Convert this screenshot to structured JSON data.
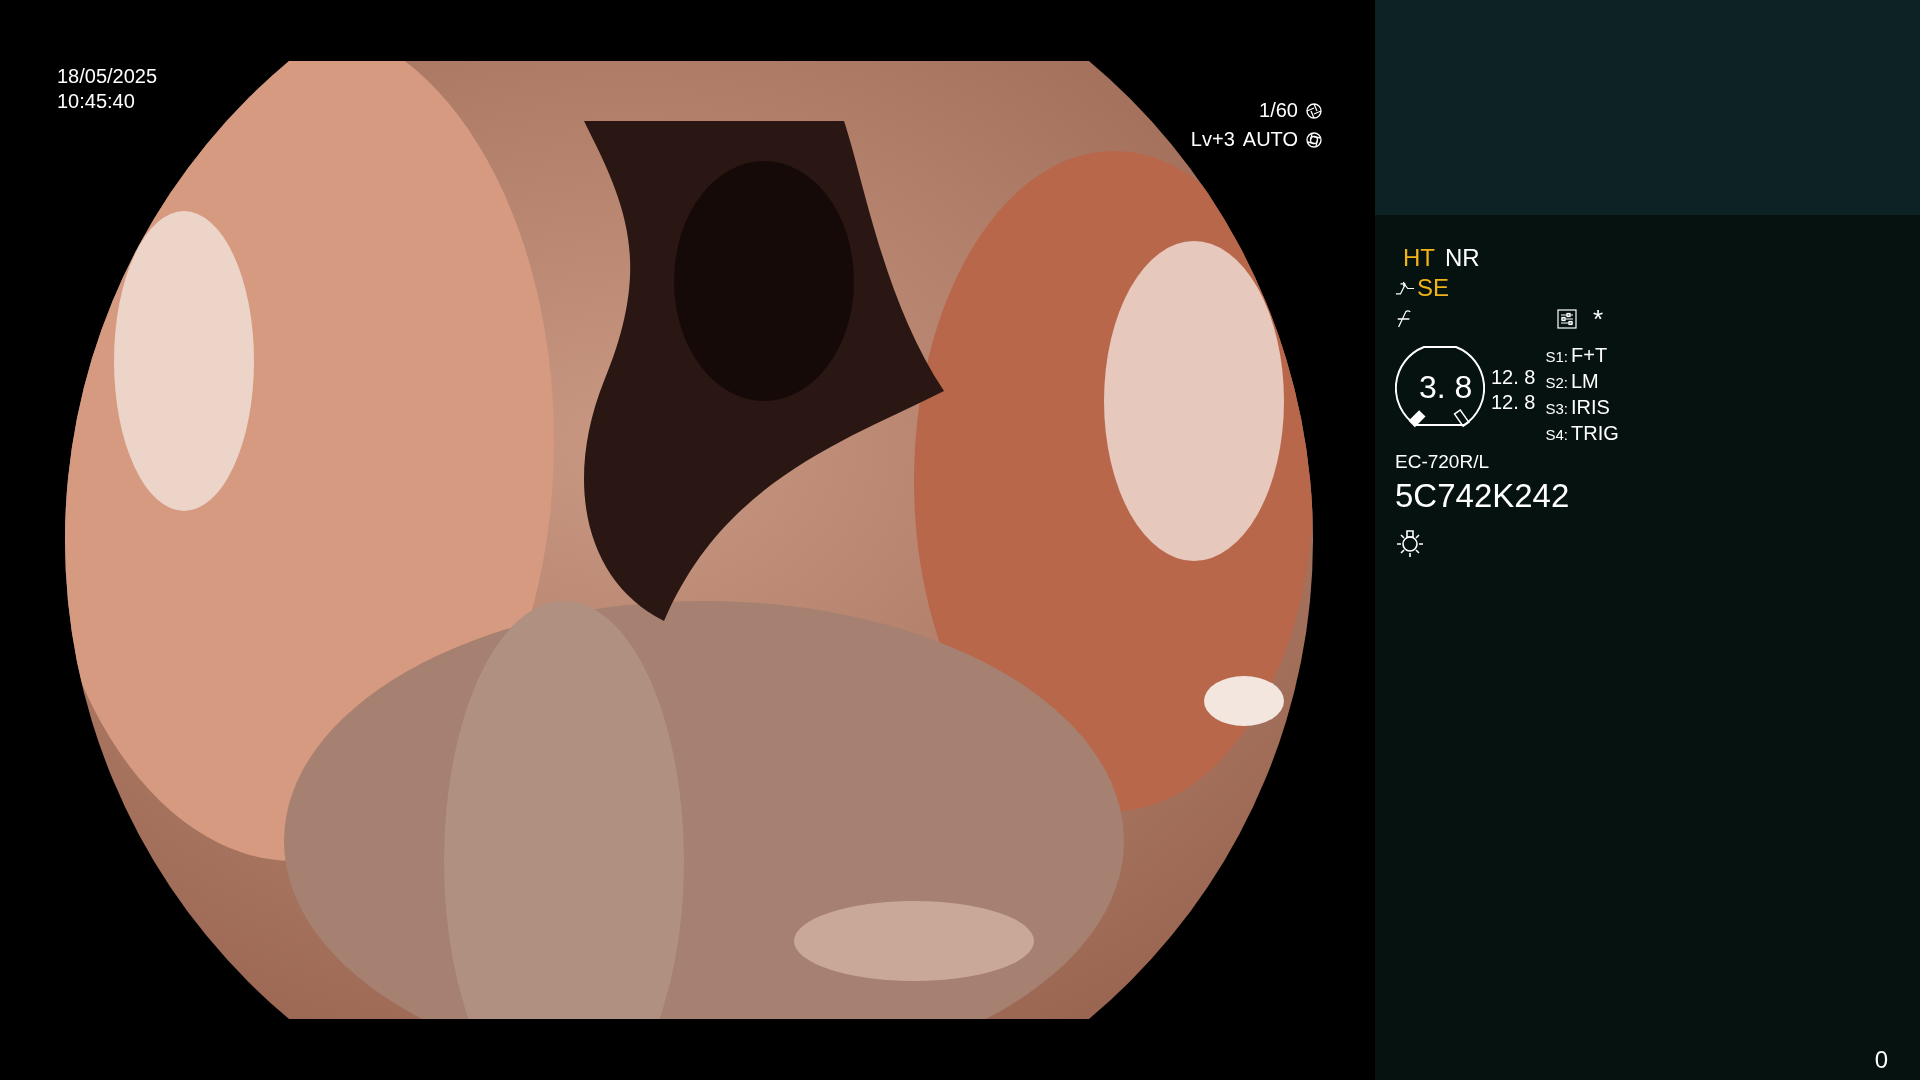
{
  "timestamp": {
    "date": "18/05/2025",
    "time": "10:45:40"
  },
  "exposure": {
    "shutter": "1/60",
    "brightness": "Lv+3",
    "mode": "AUTO"
  },
  "modes": [
    {
      "label": "HT",
      "highlighted": true
    },
    {
      "label": "NR",
      "highlighted": false
    }
  ],
  "enhancement": {
    "label": "SE",
    "highlighted": true
  },
  "marker": "*",
  "gauge": {
    "value": "3. 8",
    "readings": [
      "12. 8",
      "12. 8"
    ]
  },
  "switches": [
    {
      "key": "S1:",
      "value": "F+T"
    },
    {
      "key": "S2:",
      "value": "LM"
    },
    {
      "key": "S3:",
      "value": "IRIS"
    },
    {
      "key": "S4:",
      "value": "TRIG"
    }
  ],
  "scope": {
    "model": "EC-720R/L",
    "serial": "5C742K242"
  },
  "counter": "0"
}
